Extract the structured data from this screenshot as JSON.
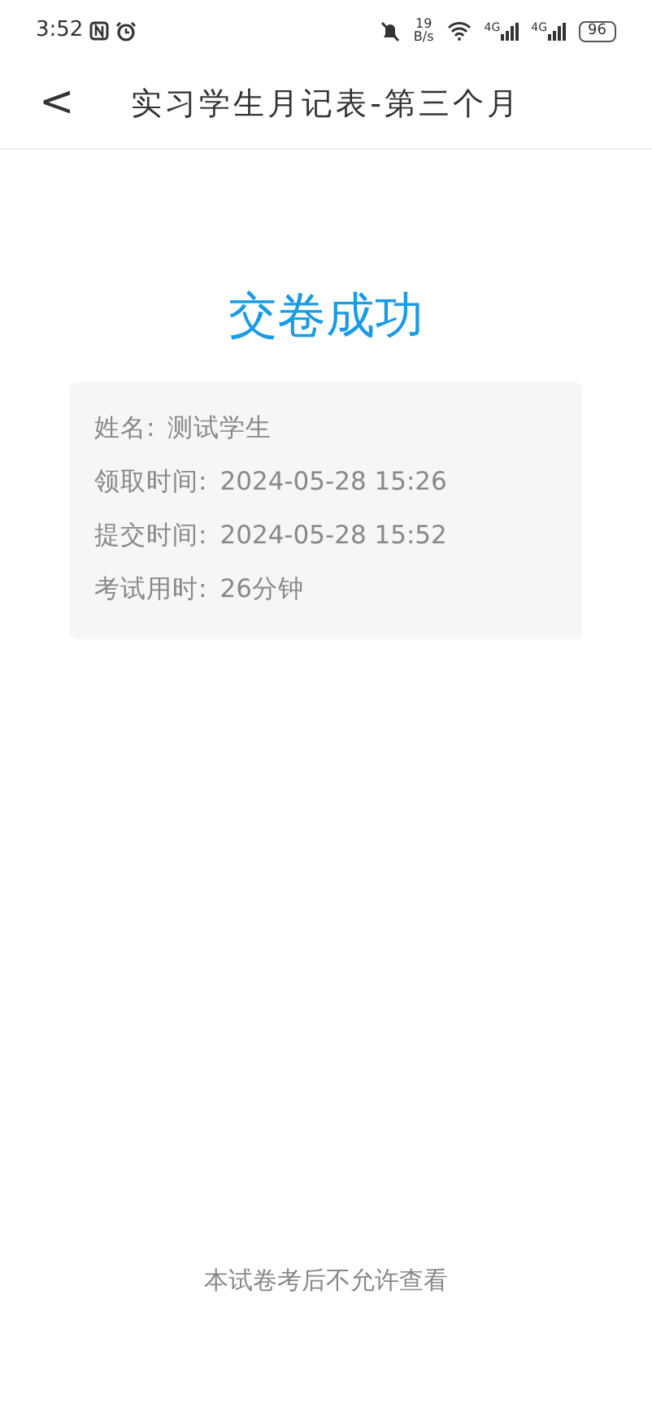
{
  "status_bar": {
    "time": "3:52",
    "speed_value": "19",
    "speed_unit": "B/s",
    "signals": [
      {
        "label": "4G"
      },
      {
        "label": "4G"
      }
    ],
    "battery": "96"
  },
  "header": {
    "back": "<",
    "title": "实习学生月记表-第三个月"
  },
  "result": {
    "title": "交卷成功",
    "rows": [
      {
        "label": "姓名:",
        "value": "测试学生"
      },
      {
        "label": "领取时间:",
        "value": "2024-05-28 15:26"
      },
      {
        "label": "提交时间:",
        "value": "2024-05-28 15:52"
      },
      {
        "label": "考试用时:",
        "value": "26分钟"
      }
    ]
  },
  "footer": {
    "note": "本试卷考后不允许查看"
  }
}
